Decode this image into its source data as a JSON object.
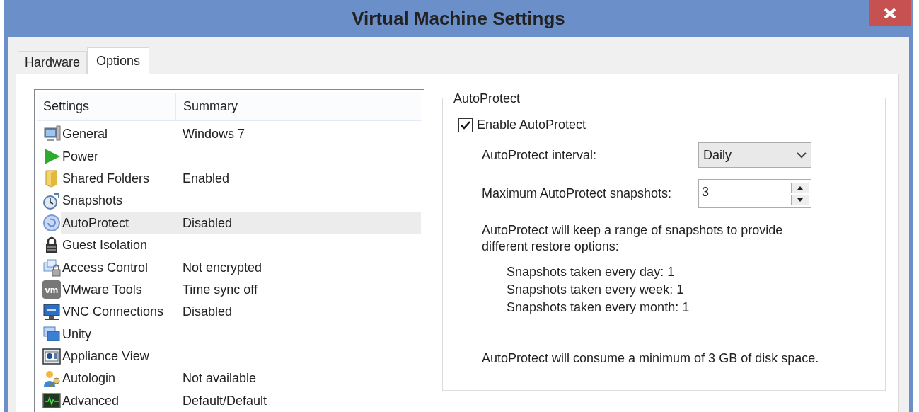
{
  "window": {
    "title": "Virtual Machine Settings"
  },
  "tabs": [
    {
      "label": "Hardware",
      "selected": false
    },
    {
      "label": "Options",
      "selected": true
    }
  ],
  "settings_list": {
    "columns": [
      "Settings",
      "Summary"
    ],
    "rows": [
      {
        "kind": "monitor",
        "name": "General",
        "summary": "Windows 7",
        "selected": false
      },
      {
        "kind": "play",
        "name": "Power",
        "selected": false
      },
      {
        "kind": "folder",
        "name": "Shared Folders",
        "summary": "Enabled",
        "selected": false
      },
      {
        "kind": "clock",
        "name": "Snapshots",
        "selected": false
      },
      {
        "kind": "restore",
        "name": "AutoProtect",
        "summary": "Disabled",
        "selected": true
      },
      {
        "kind": "padlock",
        "name": "Guest Isolation",
        "selected": false
      },
      {
        "kind": "windowslock",
        "name": "Access Control",
        "summary": "Not encrypted",
        "selected": false
      },
      {
        "kind": "badge",
        "icon_text": "vm",
        "name": "VMware Tools",
        "summary": "Time sync off",
        "selected": false
      },
      {
        "kind": "screen",
        "name": "VNC Connections",
        "summary": "Disabled",
        "selected": false
      },
      {
        "kind": "windows",
        "name": "Unity",
        "selected": false
      },
      {
        "kind": "appliance",
        "name": "Appliance View",
        "selected": false
      },
      {
        "kind": "userkey",
        "name": "Autologin",
        "summary": "Not available",
        "selected": false
      },
      {
        "kind": "pulse",
        "name": "Advanced",
        "summary": "Default/Default",
        "selected": false
      }
    ]
  },
  "autoprotect": {
    "title": "AutoProtect",
    "enable": {
      "label": "Enable AutoProtect",
      "checked": true
    },
    "interval": {
      "label": "AutoProtect interval:",
      "value": "Daily"
    },
    "max_snapshots": {
      "label": "Maximum AutoProtect snapshots:",
      "value": "3"
    },
    "description": "AutoProtect will keep a range of snapshots to provide different restore options:",
    "schedule": [
      "Snapshots taken every day: 1",
      "Snapshots taken every week: 1",
      "Snapshots taken every month: 1"
    ],
    "disk_note": "AutoProtect will consume a minimum of 3 GB of disk space."
  }
}
